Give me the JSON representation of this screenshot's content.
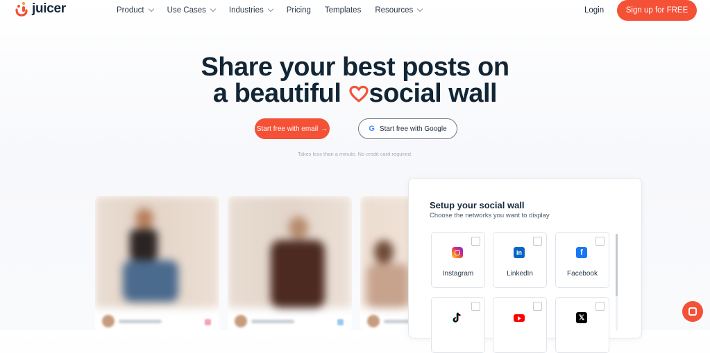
{
  "brand": {
    "name": "juicer",
    "accent": "#f45137"
  },
  "nav": {
    "links": [
      {
        "label": "Product",
        "dropdown": true
      },
      {
        "label": "Use Cases",
        "dropdown": true
      },
      {
        "label": "Industries",
        "dropdown": true
      },
      {
        "label": "Pricing",
        "dropdown": false
      },
      {
        "label": "Templates",
        "dropdown": false
      },
      {
        "label": "Resources",
        "dropdown": true
      }
    ],
    "login": "Login",
    "signup": "Sign up for FREE"
  },
  "hero": {
    "line1": "Share your best posts on",
    "line2_a": "a beautiful",
    "line2_b": "social wall",
    "cta_email": "Start free with email",
    "cta_email_arrow": "→",
    "cta_google": "Start free with Google",
    "google_glyph": "G",
    "note": "Takes less than a minute. No credit card required."
  },
  "setup": {
    "title": "Setup your social wall",
    "subtitle": "Choose the networks you want to display",
    "networks": [
      {
        "label": "Instagram",
        "icon": "instagram-icon",
        "color": "#d62976"
      },
      {
        "label": "LinkedIn",
        "icon": "linkedin-icon",
        "color": "#0a66c2"
      },
      {
        "label": "Facebook",
        "icon": "facebook-icon",
        "color": "#1877f2"
      },
      {
        "label": "",
        "icon": "tiktok-icon",
        "color": "#000000"
      },
      {
        "label": "",
        "icon": "youtube-icon",
        "color": "#ff0000"
      },
      {
        "label": "",
        "icon": "x-icon",
        "color": "#000000"
      }
    ]
  }
}
